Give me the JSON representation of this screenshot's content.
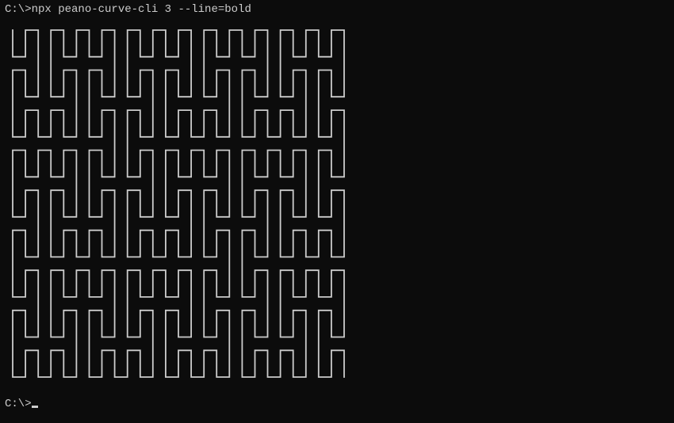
{
  "terminal": {
    "prompt": "C:\\>",
    "command": "npx peano-curve-cli 3 --line=bold"
  },
  "curve": {
    "type": "peano",
    "order": 3,
    "line_style": "bold",
    "grid_size": 27,
    "stroke_color": "#cccccc"
  }
}
